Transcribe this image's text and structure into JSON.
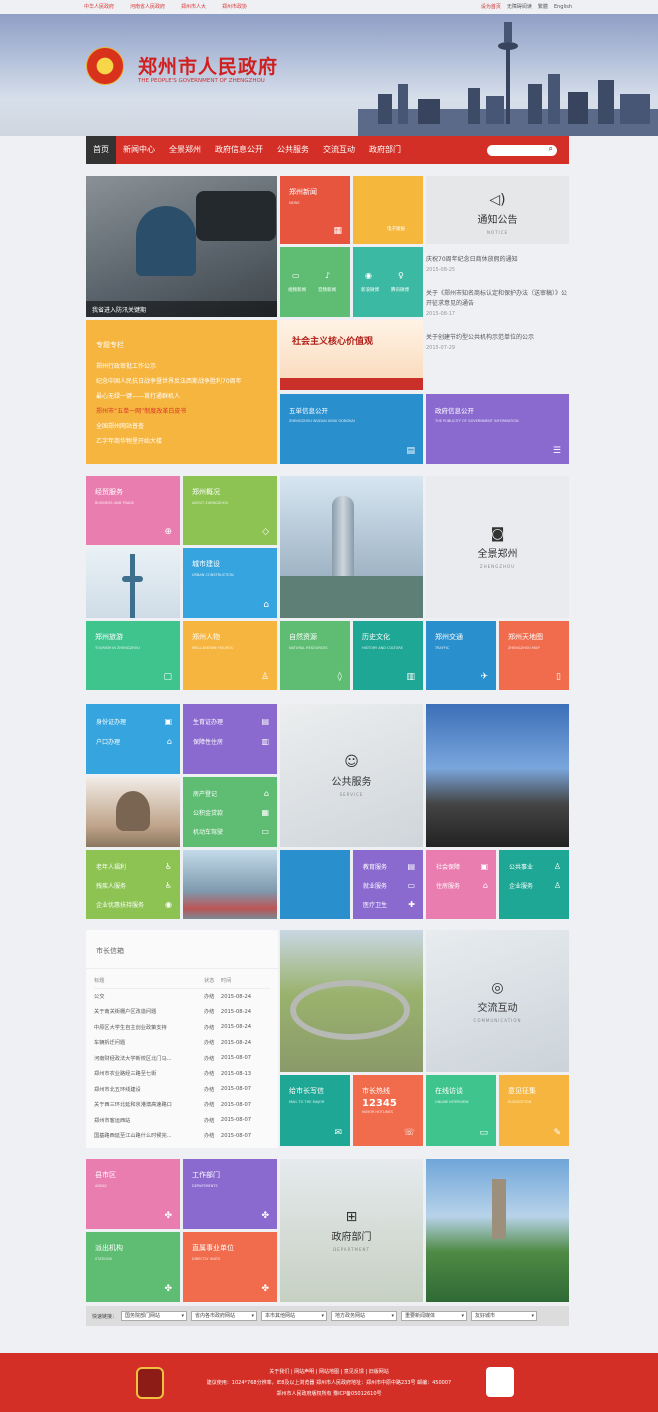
{
  "topbar": {
    "links": [
      "中华人民政府",
      "河南省人民政府",
      "郑州市人大",
      "郑州市政协"
    ],
    "right": [
      "设为首页",
      "无障碍阅读",
      "繁體",
      "English"
    ]
  },
  "header": {
    "title": "郑州市人民政府",
    "subtitle": "THE PEOPLE'S GOVERNMENT OF ZHENGZHOU"
  },
  "nav": [
    "首页",
    "新闻中心",
    "全景郑州",
    "政府信息公开",
    "公共服务",
    "交流互动",
    "政府部门"
  ],
  "hero": {
    "caption": "我省进入防汛关键期"
  },
  "tiles1": {
    "news": {
      "cn": "郑州新闻",
      "en": "NEWS"
    },
    "epaper": "电子版报",
    "video": "视频新闻",
    "audio": "音频新闻",
    "weibo": "新浪微博",
    "tencent": "腾讯微博",
    "notice": {
      "cn": "通知公告",
      "en": "NOTICE"
    },
    "special": "专题专栏",
    "wuzhong": {
      "cn": "五单信息公开",
      "en": "ZHENGZHOU WUDAN XINXI GONGKAI"
    },
    "gov": {
      "cn": "政府信息公开",
      "en": "THE PUBLICITY OF GOVERNMENT INFORMATION"
    },
    "core": "社会主义核心价值观"
  },
  "special_items": [
    "郑州行政审批工作公示",
    "纪念中国人民抗日战争暨世界反法西斯战争胜利70周年",
    "最心无绿一键——首打通群机人",
    "郑州市“五单一网”制度改革白皮书",
    "全国郑州网站普查",
    "乙字年商华物里开始大楼"
  ],
  "notices": [
    {
      "t": "庆祝70周年纪念日商休放假的通知",
      "d": "2015-08-25"
    },
    {
      "t": "关于《郑州市知名商标认定和保护办法（送审稿）》公开征求意见的通告",
      "d": "2015-08-17"
    },
    {
      "t": "关于创建节约型公共机构示范单位的公示",
      "d": "2015-07-29"
    }
  ],
  "sec2": {
    "trade": {
      "cn": "经贸服务",
      "en": "BUSINESS AND TRADE"
    },
    "about": {
      "cn": "郑州概况",
      "en": "ABOUT ZHENGZHOU"
    },
    "urban": {
      "cn": "城市建设",
      "en": "URBAN CONSTRUCTION"
    },
    "pano": {
      "cn": "全景郑州",
      "en": "ZHENGZHOU"
    },
    "tourism": {
      "cn": "郑州旅游",
      "en": "TOURISM IN ZHENGZHOU"
    },
    "figures": {
      "cn": "郑州人物",
      "en": "WELL-KNOWN FIGURES"
    },
    "natural": {
      "cn": "自然资源",
      "en": "NATURAL RESOURCES"
    },
    "history": {
      "cn": "历史文化",
      "en": "HISTORY AND CULTURE"
    },
    "traffic": {
      "cn": "郑州交通",
      "en": "TRAFFIC"
    },
    "map": {
      "cn": "郑州天地图",
      "en": "ZHENGZHOU MAP"
    }
  },
  "sec3": {
    "id": "身份证办理",
    "hukou": "户口办理",
    "birth": "生育证办理",
    "housing": "保障性住房",
    "prop": "房产登记",
    "fund": "公积金贷款",
    "vehicle": "机动车驾驶",
    "service": {
      "cn": "公共服务",
      "en": "SERVICE"
    },
    "elder": "老年人福利",
    "disabled": "残疾人服务",
    "enterprise": "企业优惠扶持服务",
    "edu": "教育服务",
    "job": "就业服务",
    "med": "医疗卫生",
    "social": "社会保障",
    "house": "住房服务",
    "public": "公共事业",
    "entsvc": "企业服务"
  },
  "mayor": {
    "title": "市长信箱",
    "head": [
      "标题",
      "状态",
      "时间"
    ],
    "rows": [
      [
        "公交",
        "办结",
        "2015-08-24"
      ],
      [
        "关于南关街棚户区改造问题",
        "办结",
        "2015-08-24"
      ],
      [
        "中原区大学生自主创业政策支持",
        "办结",
        "2015-08-24"
      ],
      [
        "车辆拆迁问题",
        "办结",
        "2015-08-24"
      ],
      [
        "河南财经政法大学新校区北门马...",
        "办结",
        "2015-08-07"
      ],
      [
        "郑州市农业路经三路至七街",
        "办结",
        "2015-08-13"
      ],
      [
        "郑州市北五环线建设",
        "办结",
        "2015-08-07"
      ],
      [
        "关于西三环北延和京港澳高速路口",
        "办结",
        "2015-08-07"
      ],
      [
        "郑州市客运西站",
        "办结",
        "2015-08-07"
      ],
      [
        "国基路西延至江山路什么时候完...",
        "办结",
        "2015-08-07"
      ]
    ]
  },
  "sec4": {
    "comm": {
      "cn": "交流互动",
      "en": "COMMUNICATION"
    },
    "mail": {
      "cn": "给市长写信",
      "en": "MAIL TO THE MAJOR"
    },
    "hotline": {
      "cn": "市长热线",
      "num": "12345",
      "en": "MAYOR HOTLINES"
    },
    "interview": {
      "cn": "在线访谈",
      "en": "ONLINE INTERVIEW"
    },
    "suggest": {
      "cn": "意见征集",
      "en": "SUGGESTION"
    }
  },
  "sec5": {
    "areas": {
      "cn": "县市区",
      "en": "AREAS"
    },
    "depts": {
      "cn": "工作部门",
      "en": "DEPARTMENTS"
    },
    "stations": {
      "cn": "派出机构",
      "en": "STATIONS"
    },
    "units": {
      "cn": "直属事业单位",
      "en": "DIRECTLY UNITS"
    },
    "dept": {
      "cn": "政府部门",
      "en": "DEPARTMENT"
    }
  },
  "quick": {
    "label": "快速链接：",
    "opts": [
      "国务院部门网站",
      "省内各市政府网站",
      "本市其他网站",
      "地方政务网站",
      "重要新闻媒体",
      "友好城市"
    ]
  },
  "footer": {
    "links": "关于我们 | 网站声明 | 网站地图 | 意见反馈 | 旧版网站",
    "l2": "建议使用：1024*768分辨率，IE8及以上浏览器  郑州市人民政府地址：郑州市中原中路233号  邮编：450007",
    "l3": "郑州市人民政府版权所有  豫ICP备05012610号"
  }
}
